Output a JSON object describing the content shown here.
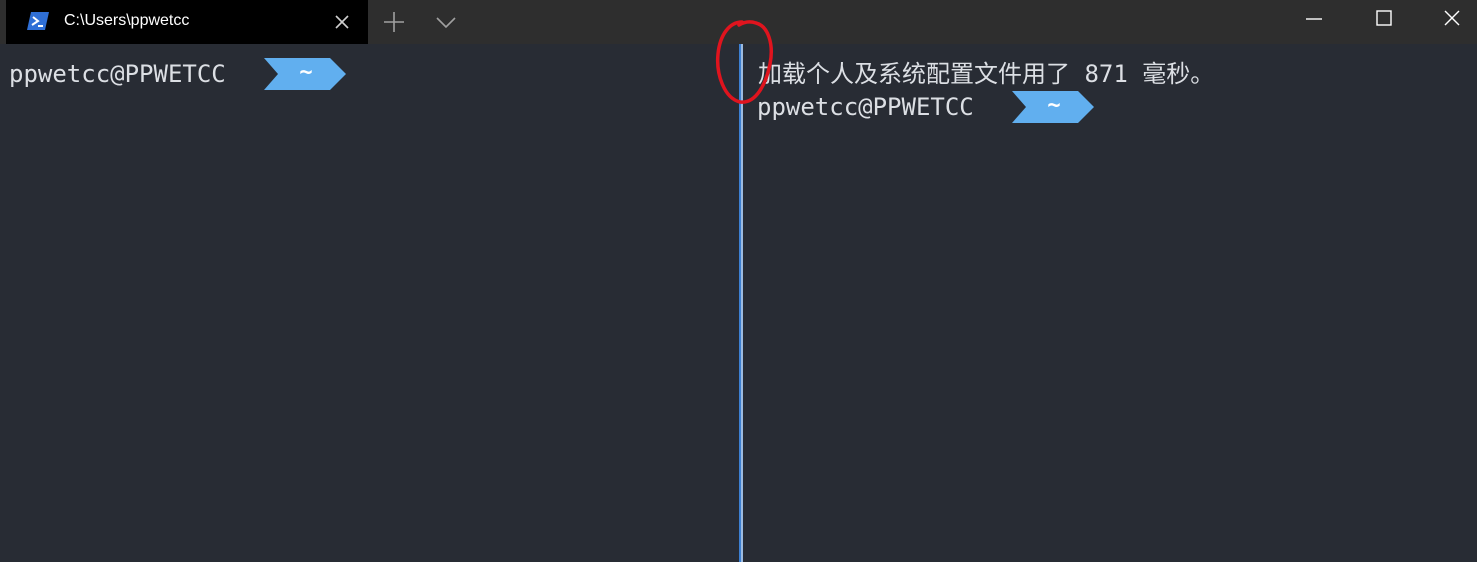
{
  "tab": {
    "title": "C:\\Users\\ppwetcc",
    "icon": "powershell-icon"
  },
  "titlebar": {
    "new_tab_icon": "plus-icon",
    "dropdown_icon": "chevron-down-icon",
    "minimize_icon": "minimize-icon",
    "maximize_icon": "maximize-icon",
    "close_icon": "close-icon"
  },
  "left_pane": {
    "prompt_user": "ppwetcc@PPWETCC",
    "prompt_dir": "~"
  },
  "right_pane": {
    "load_message": "加载个人及系统配置文件用了 871 毫秒。",
    "prompt_user": "ppwetcc@PPWETCC",
    "prompt_dir": "~"
  },
  "colors": {
    "background": "#282c34",
    "titlebar": "#2e2e2e",
    "active_tab": "#000000",
    "prompt_chip": "#61afef",
    "focus_border": "#3c7fd1",
    "annotation": "#e0141e"
  }
}
